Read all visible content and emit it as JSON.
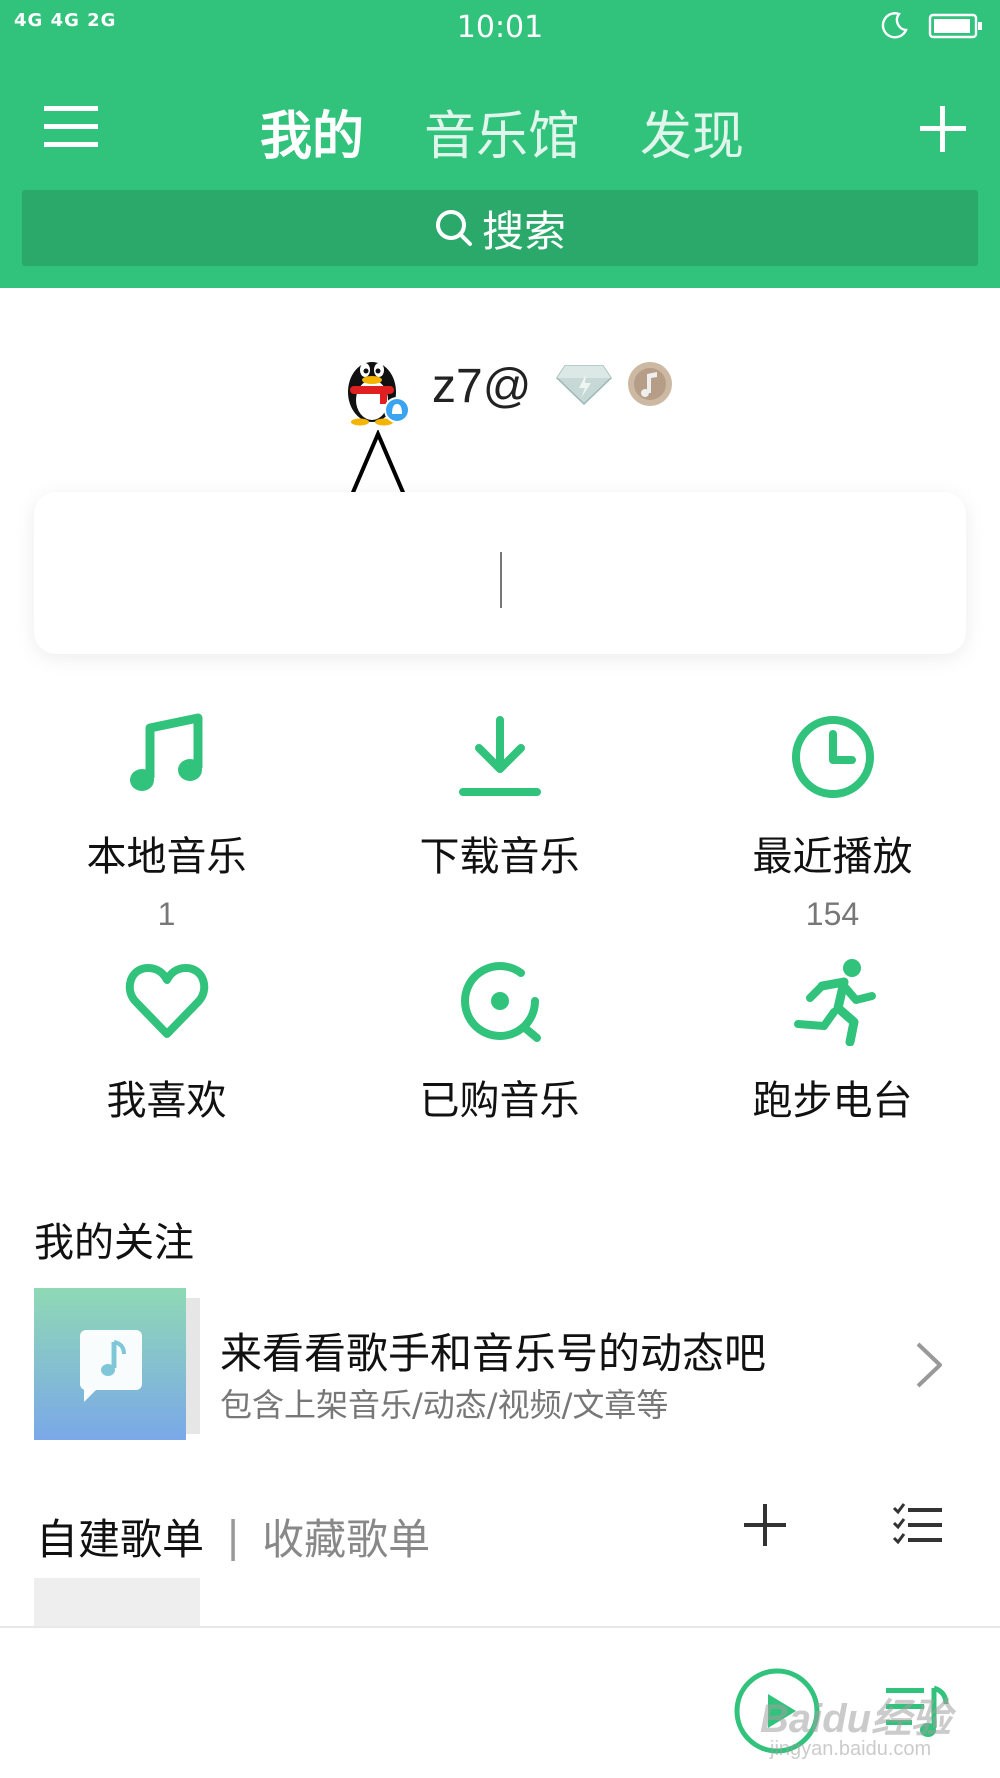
{
  "status_bar": {
    "signal": "4G 4G 2G",
    "time": "10:01"
  },
  "tabs": [
    {
      "label": "我的"
    },
    {
      "label": "音乐馆"
    },
    {
      "label": "发现"
    }
  ],
  "search": {
    "label": "搜索"
  },
  "profile": {
    "username": "z7@"
  },
  "grid": [
    {
      "label": "本地音乐",
      "count": "1",
      "icon": "music-note-icon"
    },
    {
      "label": "下载音乐",
      "count": "",
      "icon": "download-icon"
    },
    {
      "label": "最近播放",
      "count": "154",
      "icon": "clock-icon"
    },
    {
      "label": "我喜欢",
      "count": "",
      "icon": "heart-icon"
    },
    {
      "label": "已购音乐",
      "count": "",
      "icon": "purchased-disc-icon"
    },
    {
      "label": "跑步电台",
      "count": "",
      "icon": "running-icon"
    }
  ],
  "follow_section": {
    "title": "我的关注",
    "item_title": "来看看歌手和音乐号的动态吧",
    "item_sub": "包含上架音乐/动态/视频/文章等"
  },
  "playlists": {
    "active": "自建歌单",
    "separator": "|",
    "inactive": "收藏歌单"
  },
  "watermark": {
    "brand": "Baidu经验",
    "url": "jingyan.baidu.com"
  },
  "colors": {
    "brand": "#31c27c",
    "search_bg": "#2aa96b",
    "text": "#222222",
    "muted": "#777777"
  }
}
